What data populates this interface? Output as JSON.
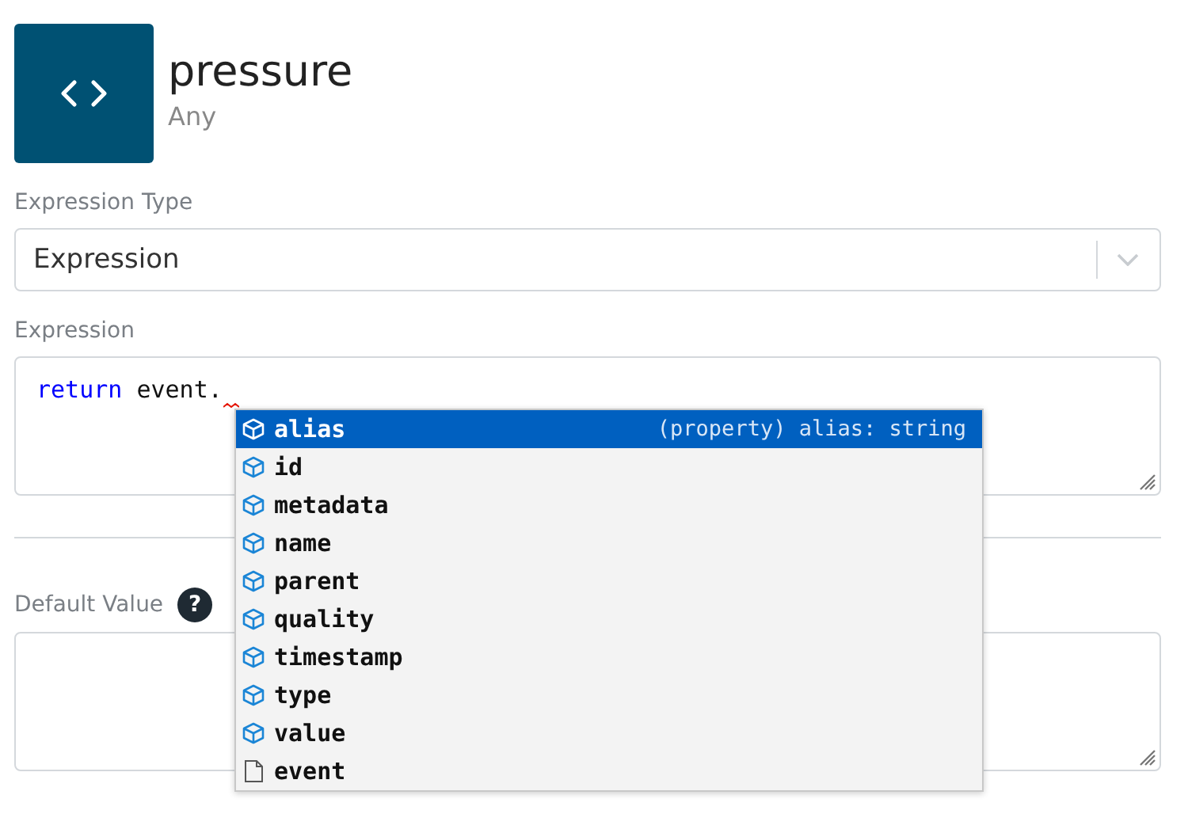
{
  "header": {
    "title": "pressure",
    "subtitle": "Any"
  },
  "expression_type": {
    "label": "Expression Type",
    "value": "Expression"
  },
  "expression": {
    "label": "Expression",
    "code": [
      {
        "kind": "keyword",
        "text": "return"
      },
      {
        "kind": "plain",
        "text": " event."
      }
    ],
    "suggestions": [
      {
        "kind": "property",
        "label": "alias",
        "detail": "(property) alias: string",
        "selected": true
      },
      {
        "kind": "property",
        "label": "id",
        "selected": false
      },
      {
        "kind": "property",
        "label": "metadata",
        "selected": false
      },
      {
        "kind": "property",
        "label": "name",
        "selected": false
      },
      {
        "kind": "property",
        "label": "parent",
        "selected": false
      },
      {
        "kind": "property",
        "label": "quality",
        "selected": false
      },
      {
        "kind": "property",
        "label": "timestamp",
        "selected": false
      },
      {
        "kind": "property",
        "label": "type",
        "selected": false
      },
      {
        "kind": "property",
        "label": "value",
        "selected": false
      },
      {
        "kind": "variable",
        "label": "event",
        "selected": false
      }
    ]
  },
  "default_value": {
    "label": "Default Value",
    "help": "?"
  }
}
